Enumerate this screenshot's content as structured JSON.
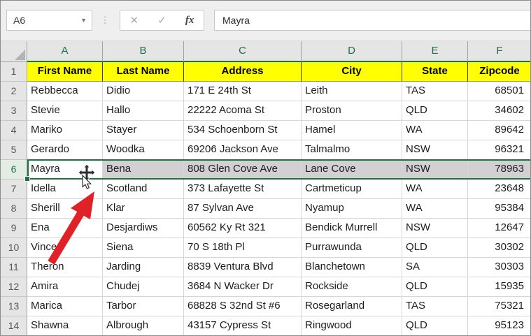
{
  "formula_bar": {
    "name_box_value": "A6",
    "formula_value": "Mayra",
    "cancel_icon": "✕",
    "enter_icon": "✓",
    "fx_label": "fx",
    "grip_icon": "⋮",
    "dropdown_icon": "▼"
  },
  "grid": {
    "column_headers": [
      "A",
      "B",
      "C",
      "D",
      "E",
      "F"
    ],
    "field_headers": [
      "First Name",
      "Last Name",
      "Address",
      "City",
      "State",
      "Zipcode"
    ],
    "first_data_row_number": 2,
    "rows": [
      [
        "Rebbecca",
        "Didio",
        "171 E 24th St",
        "Leith",
        "TAS",
        "68501"
      ],
      [
        "Stevie",
        "Hallo",
        "22222 Acoma St",
        "Proston",
        "QLD",
        "34602"
      ],
      [
        "Mariko",
        "Stayer",
        "534 Schoenborn St",
        "Hamel",
        "WA",
        "89642"
      ],
      [
        "Gerardo",
        "Woodka",
        "69206 Jackson Ave",
        "Talmalmo",
        "NSW",
        "96321"
      ],
      [
        "Mayra",
        "Bena",
        "808 Glen Cove Ave",
        "Lane Cove",
        "NSW",
        "78963"
      ],
      [
        "Idella",
        "Scotland",
        "373 Lafayette St",
        "Cartmeticup",
        "WA",
        "23648"
      ],
      [
        "Sherill",
        "Klar",
        "87 Sylvan Ave",
        "Nyamup",
        "WA",
        "95384"
      ],
      [
        "Ena",
        "Desjardiws",
        "60562 Ky Rt 321",
        "Bendick Murrell",
        "NSW",
        "12647"
      ],
      [
        "Vince",
        "Siena",
        "70 S 18th Pl",
        "Purrawunda",
        "QLD",
        "30302"
      ],
      [
        "Theron",
        "Jarding",
        "8839 Ventura Blvd",
        "Blanchetown",
        "SA",
        "30303"
      ],
      [
        "Amira",
        "Chudej",
        "3684 N Wacker Dr",
        "Rockside",
        "QLD",
        "15935"
      ],
      [
        "Marica",
        "Tarbor",
        "68828 S 32nd St #6",
        "Rosegarland",
        "TAS",
        "75321"
      ],
      [
        "Shawna",
        "Albrough",
        "43157 Cypress St",
        "Ringwood",
        "QLD",
        "95123"
      ]
    ],
    "selected_row_number": 6,
    "active_cell": "A6"
  },
  "colors": {
    "accent_green": "#1E7145",
    "header_yellow": "#FFFF00",
    "selected_row_fill": "#D2D0D0",
    "arrow_red": "#E02127"
  }
}
